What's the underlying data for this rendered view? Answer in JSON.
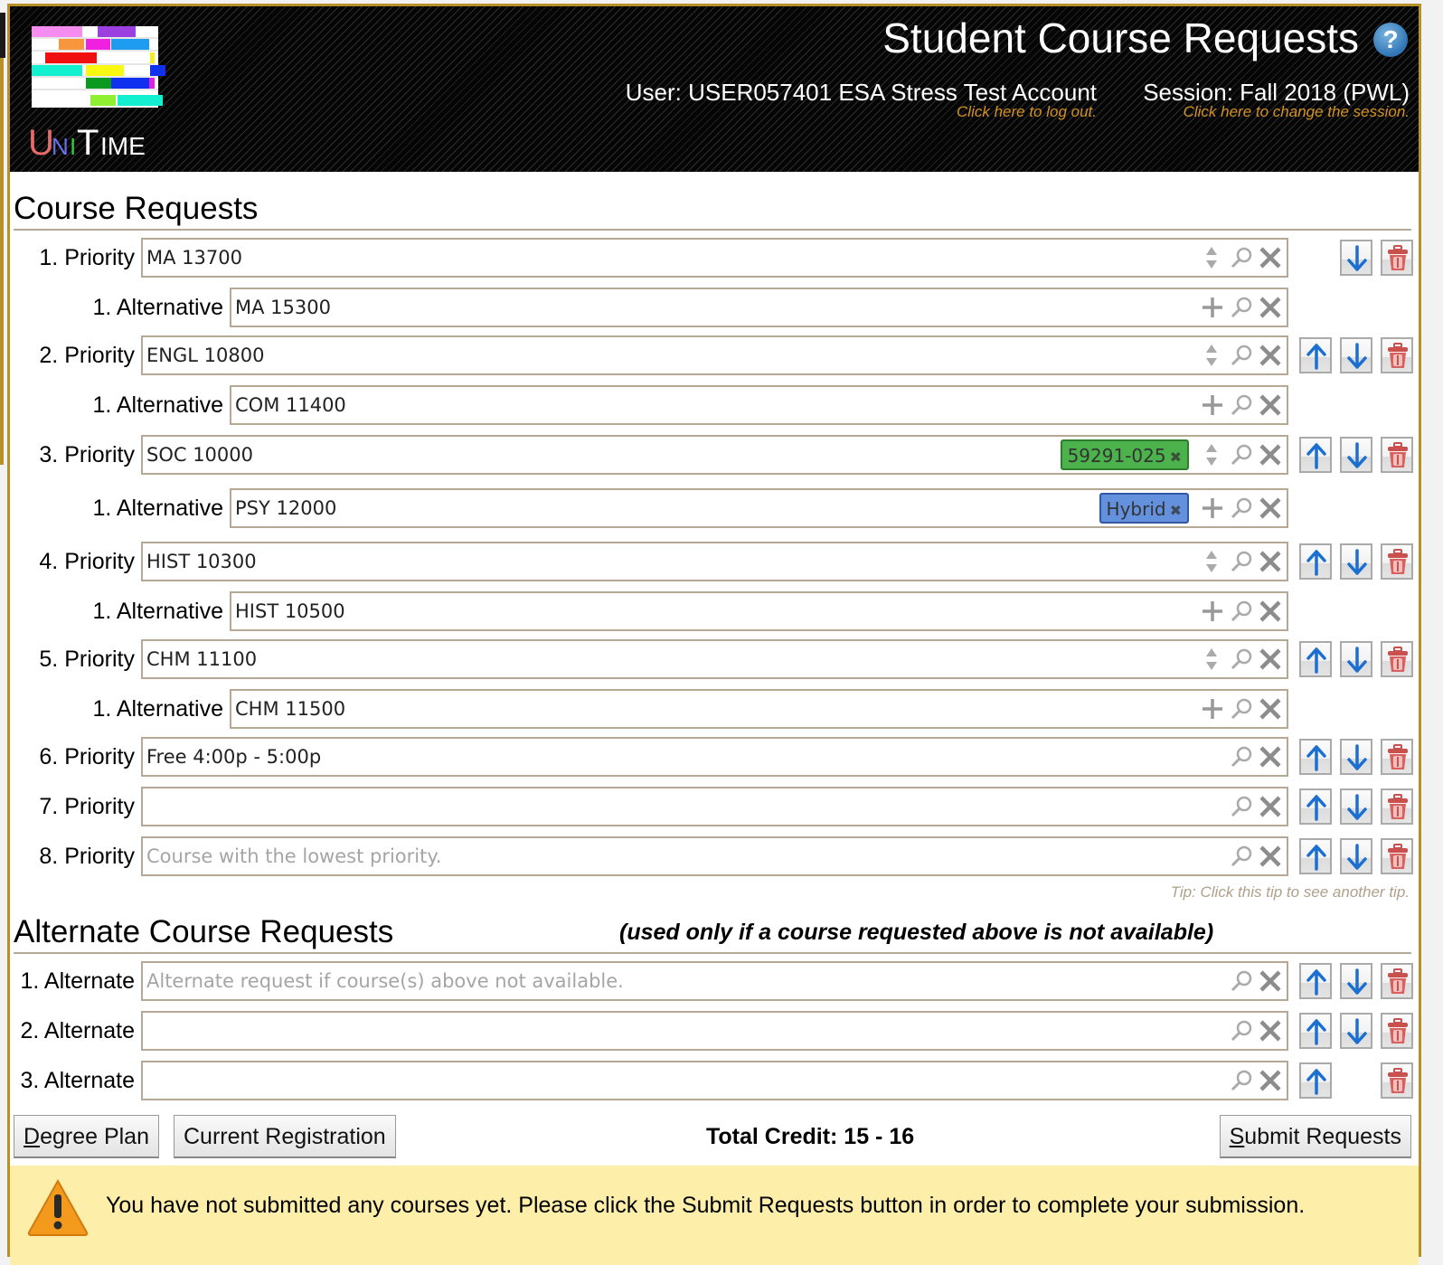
{
  "header": {
    "app_name": "UniTime",
    "title": "Student Course Requests",
    "user_label": "User: USER057401 ESA Stress Test Account",
    "logout_link": "Click here to log out.",
    "session_label": "Session: Fall 2018 (PWL)",
    "change_session_link": "Click here to change the session."
  },
  "course_requests": {
    "title": "Course Requests",
    "rows": [
      {
        "label": "1. Priority",
        "type": "priority",
        "value": "MA 13700",
        "placeholder": false,
        "chip": null,
        "icons": [
          "updown",
          "search",
          "clear"
        ],
        "buttons": [
          "down",
          "delete"
        ]
      },
      {
        "label": "1. Alternative",
        "type": "alternative",
        "value": "MA 15300",
        "placeholder": false,
        "chip": null,
        "icons": [
          "add",
          "search",
          "clear"
        ],
        "buttons": []
      },
      {
        "label": "2. Priority",
        "type": "priority",
        "value": "ENGL 10800",
        "placeholder": false,
        "chip": null,
        "icons": [
          "updown",
          "search",
          "clear"
        ],
        "buttons": [
          "up",
          "down",
          "delete"
        ]
      },
      {
        "label": "1. Alternative",
        "type": "alternative",
        "value": "COM 11400",
        "placeholder": false,
        "chip": null,
        "icons": [
          "add",
          "search",
          "clear"
        ],
        "buttons": []
      },
      {
        "label": "3. Priority",
        "type": "priority",
        "value": "SOC 10000",
        "placeholder": false,
        "chip": {
          "text": "59291-025",
          "color": "green"
        },
        "icons": [
          "updown",
          "search",
          "clear"
        ],
        "buttons": [
          "up",
          "down",
          "delete"
        ]
      },
      {
        "label": "1. Alternative",
        "type": "alternative",
        "value": "PSY 12000",
        "placeholder": false,
        "chip": {
          "text": "Hybrid",
          "color": "blue"
        },
        "icons": [
          "add",
          "search",
          "clear"
        ],
        "buttons": []
      },
      {
        "label": "4. Priority",
        "type": "priority",
        "value": "HIST 10300",
        "placeholder": false,
        "chip": null,
        "icons": [
          "updown",
          "search",
          "clear"
        ],
        "buttons": [
          "up",
          "down",
          "delete"
        ]
      },
      {
        "label": "1. Alternative",
        "type": "alternative",
        "value": "HIST 10500",
        "placeholder": false,
        "chip": null,
        "icons": [
          "add",
          "search",
          "clear"
        ],
        "buttons": []
      },
      {
        "label": "5. Priority",
        "type": "priority",
        "value": "CHM 11100",
        "placeholder": false,
        "chip": null,
        "icons": [
          "updown",
          "search",
          "clear"
        ],
        "buttons": [
          "up",
          "down",
          "delete"
        ]
      },
      {
        "label": "1. Alternative",
        "type": "alternative",
        "value": "CHM 11500",
        "placeholder": false,
        "chip": null,
        "icons": [
          "add",
          "search",
          "clear"
        ],
        "buttons": []
      },
      {
        "label": "6. Priority",
        "type": "priority",
        "value": "Free 4:00p - 5:00p",
        "placeholder": false,
        "chip": null,
        "icons": [
          "search",
          "clear"
        ],
        "buttons": [
          "up",
          "down",
          "delete"
        ]
      },
      {
        "label": "7. Priority",
        "type": "priority",
        "value": "",
        "placeholder": false,
        "chip": null,
        "icons": [
          "search",
          "clear"
        ],
        "buttons": [
          "up",
          "down",
          "delete"
        ]
      },
      {
        "label": "8. Priority",
        "type": "priority",
        "value": "Course with the lowest priority.",
        "placeholder": true,
        "chip": null,
        "icons": [
          "search",
          "clear"
        ],
        "buttons": [
          "up",
          "down",
          "delete"
        ]
      }
    ],
    "tip": "Tip: Click this tip to see another tip."
  },
  "alternate_requests": {
    "title": "Alternate Course Requests",
    "note": "(used only if a course requested above is not available)",
    "rows": [
      {
        "label": "1. Alternate",
        "type": "alternate",
        "value": "Alternate request if course(s) above not available.",
        "placeholder": true,
        "chip": null,
        "icons": [
          "search",
          "clear"
        ],
        "buttons": [
          "up",
          "down",
          "delete"
        ]
      },
      {
        "label": "2. Alternate",
        "type": "alternate",
        "value": "",
        "placeholder": false,
        "chip": null,
        "icons": [
          "search",
          "clear"
        ],
        "buttons": [
          "up",
          "down",
          "delete"
        ]
      },
      {
        "label": "3. Alternate",
        "type": "alternate",
        "value": "",
        "placeholder": false,
        "chip": null,
        "icons": [
          "search",
          "clear"
        ],
        "buttons": [
          "up",
          "delete"
        ]
      }
    ]
  },
  "footer": {
    "degree_plan_label": "Degree Plan",
    "current_registration_label": "Current Registration",
    "total_credit": "Total Credit: 15 - 16",
    "submit_label": "Submit Requests",
    "warning": "You have not submitted any courses yet. Please click the Submit Requests button in order to complete your submission."
  },
  "colors": {
    "frame_gold": "#b8902a",
    "link_orange": "#d49220",
    "chip_green": "#4cb24c",
    "chip_blue": "#6391dd",
    "arrow_blue": "#1a6fd1",
    "trash_red": "#c9504d",
    "warning_bg": "#fdeeaa"
  }
}
